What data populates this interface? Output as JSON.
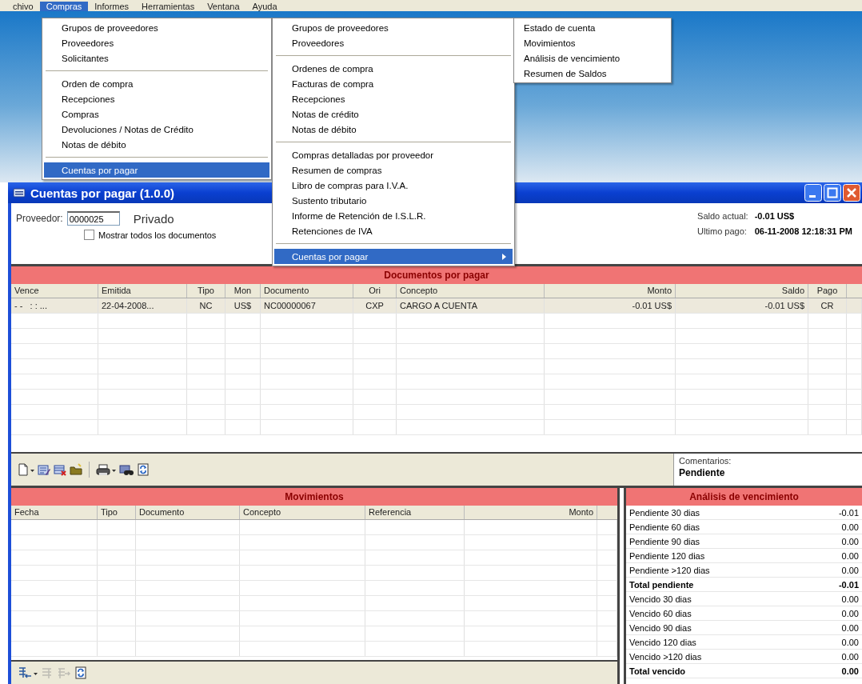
{
  "menubar": [
    {
      "label": "chivo",
      "selected": false
    },
    {
      "label": "Compras",
      "selected": true
    },
    {
      "label": "Informes",
      "selected": false
    },
    {
      "label": "Herramientas",
      "selected": false
    },
    {
      "label": "Ventana",
      "selected": false
    },
    {
      "label": "Ayuda",
      "selected": false
    }
  ],
  "menus": [
    {
      "items": [
        {
          "kind": "item",
          "label": "Grupos de proveedores",
          "selected": false,
          "submenu": false
        },
        {
          "kind": "item",
          "label": "Proveedores",
          "selected": false,
          "submenu": false
        },
        {
          "kind": "item",
          "label": "Solicitantes",
          "selected": false,
          "submenu": false
        },
        {
          "kind": "separator"
        },
        {
          "kind": "item",
          "label": "Orden de compra",
          "selected": false,
          "submenu": false
        },
        {
          "kind": "item",
          "label": "Recepciones",
          "selected": false,
          "submenu": false
        },
        {
          "kind": "item",
          "label": "Compras",
          "selected": false,
          "submenu": false
        },
        {
          "kind": "item",
          "label": "Devoluciones / Notas de Crédito",
          "selected": false,
          "submenu": false
        },
        {
          "kind": "item",
          "label": "Notas de débito",
          "selected": false,
          "submenu": false
        },
        {
          "kind": "separator"
        },
        {
          "kind": "item",
          "label": "Cuentas por pagar",
          "selected": true,
          "submenu": false
        }
      ]
    },
    {
      "items": [
        {
          "kind": "item",
          "label": "Grupos de proveedores",
          "selected": false,
          "submenu": false
        },
        {
          "kind": "item",
          "label": "Proveedores",
          "selected": false,
          "submenu": false
        },
        {
          "kind": "separator"
        },
        {
          "kind": "item",
          "label": "Ordenes de compra",
          "selected": false,
          "submenu": false
        },
        {
          "kind": "item",
          "label": "Facturas de compra",
          "selected": false,
          "submenu": false
        },
        {
          "kind": "item",
          "label": "Recepciones",
          "selected": false,
          "submenu": false
        },
        {
          "kind": "item",
          "label": "Notas de crédito",
          "selected": false,
          "submenu": false
        },
        {
          "kind": "item",
          "label": "Notas de débito",
          "selected": false,
          "submenu": false
        },
        {
          "kind": "separator"
        },
        {
          "kind": "item",
          "label": "Compras detalladas por proveedor",
          "selected": false,
          "submenu": false
        },
        {
          "kind": "item",
          "label": "Resumen de compras",
          "selected": false,
          "submenu": false
        },
        {
          "kind": "item",
          "label": "Libro de compras para I.V.A.",
          "selected": false,
          "submenu": false
        },
        {
          "kind": "item",
          "label": "Sustento tributario",
          "selected": false,
          "submenu": false
        },
        {
          "kind": "item",
          "label": "Informe de Retención de I.S.L.R.",
          "selected": false,
          "submenu": false
        },
        {
          "kind": "item",
          "label": "Retenciones de IVA",
          "selected": false,
          "submenu": false
        },
        {
          "kind": "separator"
        },
        {
          "kind": "item",
          "label": "Cuentas por pagar",
          "selected": true,
          "submenu": true
        }
      ]
    },
    {
      "items": [
        {
          "kind": "item",
          "label": "Estado de cuenta",
          "selected": false,
          "submenu": false
        },
        {
          "kind": "item",
          "label": "Movimientos",
          "selected": false,
          "submenu": false
        },
        {
          "kind": "item",
          "label": "Análisis de vencimiento",
          "selected": false,
          "submenu": false
        },
        {
          "kind": "item",
          "label": "Resumen de Saldos",
          "selected": false,
          "submenu": false
        }
      ]
    }
  ],
  "window": {
    "title": "Cuentas por pagar (1.0.0)"
  },
  "form": {
    "supplier_label": "Proveedor:",
    "supplier_value": "0000025",
    "supplier_name": "Privado",
    "show_all": {
      "label": "Mostrar todos los documentos",
      "checked": false
    },
    "balance_label": "Saldo actual:",
    "balance_value": "-0.01 US$",
    "last_payment_label": "Ultimo pago:",
    "last_payment_value": "06-11-2008 12:18:31 PM"
  },
  "documents": {
    "title": "Documentos por pagar",
    "columns": [
      {
        "label": "Vence",
        "kind": "text"
      },
      {
        "label": "Emitida",
        "kind": "text"
      },
      {
        "label": "Tipo",
        "kind": "center"
      },
      {
        "label": "Mon",
        "kind": "center"
      },
      {
        "label": "Documento",
        "kind": "text"
      },
      {
        "label": "Ori",
        "kind": "center"
      },
      {
        "label": "Concepto",
        "kind": "text"
      },
      {
        "label": "Monto",
        "kind": "amount"
      },
      {
        "label": "Saldo",
        "kind": "amount"
      },
      {
        "label": "Pago",
        "kind": "center"
      }
    ],
    "rows": [
      {
        "selected": true,
        "cells": [
          "- -   : : ...",
          "22-04-2008...",
          "NC",
          "US$",
          "NC00000067",
          "CXP",
          "CARGO A CUENTA",
          "-0.01 US$",
          "-0.01 US$",
          "CR"
        ]
      }
    ]
  },
  "toolbar": [
    {
      "kind": "new",
      "dropdown": true,
      "disabled": false
    },
    {
      "kind": "edit",
      "dropdown": false,
      "disabled": false
    },
    {
      "kind": "delete",
      "dropdown": false,
      "disabled": false
    },
    {
      "kind": "folder",
      "dropdown": false,
      "disabled": false
    },
    {
      "kind": "separator"
    },
    {
      "kind": "print",
      "dropdown": true,
      "disabled": false
    },
    {
      "kind": "find",
      "dropdown": false,
      "disabled": false
    },
    {
      "kind": "refresh",
      "dropdown": false,
      "disabled": false
    }
  ],
  "comments": {
    "label": "Comentarios:",
    "value": "Pendiente"
  },
  "movements": {
    "title": "Movimientos",
    "columns": [
      {
        "label": "Fecha",
        "kind": "text"
      },
      {
        "label": "Tipo",
        "kind": "text"
      },
      {
        "label": "Documento",
        "kind": "text"
      },
      {
        "label": "Concepto",
        "kind": "text"
      },
      {
        "label": "Referencia",
        "kind": "text"
      },
      {
        "label": "Monto",
        "kind": "amount"
      }
    ]
  },
  "movements_toolbar": [
    {
      "kind": "add_line",
      "dropdown": true,
      "disabled": false
    },
    {
      "kind": "list",
      "dropdown": false,
      "disabled": true
    },
    {
      "kind": "list_arrow",
      "dropdown": false,
      "disabled": true
    },
    {
      "kind": "refresh",
      "dropdown": false,
      "disabled": false
    }
  ],
  "aging": {
    "title": "Análisis de vencimiento",
    "rows": [
      {
        "kind": "item",
        "label": "Pendiente 30 dias",
        "value": "-0.01"
      },
      {
        "kind": "item",
        "label": "Pendiente 60 dias",
        "value": "0.00"
      },
      {
        "kind": "item",
        "label": "Pendiente 90 dias",
        "value": "0.00"
      },
      {
        "kind": "item",
        "label": "Pendiente 120 dias",
        "value": "0.00"
      },
      {
        "kind": "item",
        "label": "Pendiente >120 dias",
        "value": "0.00"
      },
      {
        "kind": "total",
        "label": "Total pendiente",
        "value": "-0.01"
      },
      {
        "kind": "item",
        "label": "Vencido 30 dias",
        "value": "0.00"
      },
      {
        "kind": "item",
        "label": "Vencido 60 dias",
        "value": "0.00"
      },
      {
        "kind": "item",
        "label": "Vencido 90 dias",
        "value": "0.00"
      },
      {
        "kind": "item",
        "label": "Vencido 120 dias",
        "value": "0.00"
      },
      {
        "kind": "item",
        "label": "Vencido >120 dias",
        "value": "0.00"
      },
      {
        "kind": "total",
        "label": "Total vencido",
        "value": "0.00"
      }
    ]
  }
}
